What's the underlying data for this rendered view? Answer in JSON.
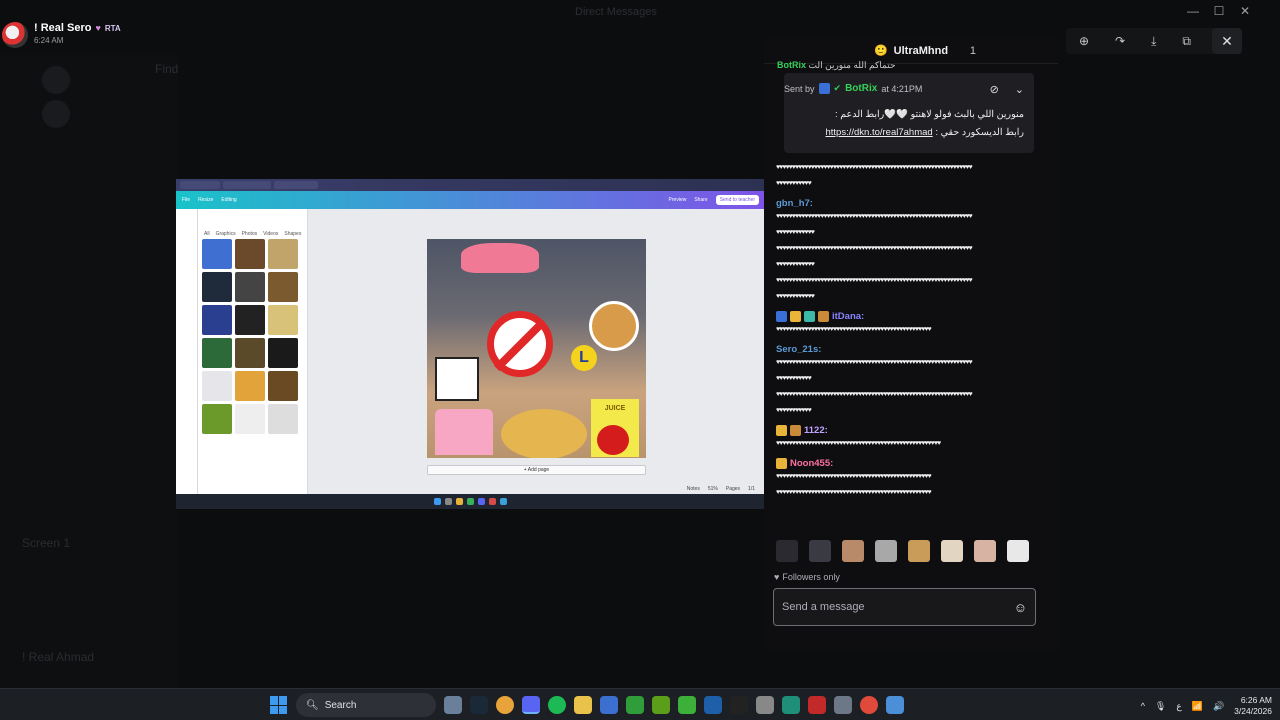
{
  "window": {
    "title": "Direct Messages",
    "controls": [
      "—",
      "☐",
      "✕"
    ]
  },
  "header": {
    "username": "! Real Sero",
    "heart": "♥",
    "badge": "RTA",
    "time": "6:24 AM"
  },
  "background_text": [
    "Find",
    "Screen 1",
    "! Real Ahmad"
  ],
  "viewer": {
    "tools": [
      "⊕",
      "↷",
      "⤓",
      "⧉",
      "···"
    ],
    "close": "✕"
  },
  "stream": {
    "canva_tabs": [
      "File",
      "Resize",
      "Editing"
    ],
    "panel_tabs": [
      "All",
      "Graphics",
      "Photos",
      "Videos",
      "Shapes"
    ],
    "add_page": "+ Add page",
    "preview": "Preview",
    "share": "Share",
    "send": "Send to teacher",
    "footer": [
      "Notes",
      "Pages",
      "1/1",
      "51%"
    ],
    "design_letter": "L",
    "juice": "JUICE"
  },
  "chat": {
    "channel": "UltraMhnd",
    "count": "1",
    "top_partial_user": "BotRix",
    "top_partial_text": "حتماكم الله منورين الت",
    "pinned": {
      "sent_by": "Sent by",
      "user": "BotRix",
      "at": "at 4:21PM",
      "line1": "منورين اللي بالبث فولو لاهنتو 🤍🤍رابط الدعم :",
      "link": "https://dkn.to/real7ahmad",
      "line2": "رابط الديسكورد حقي :"
    },
    "messages": [
      {
        "user": "",
        "color": "#efeff1",
        "lines": [
          "♥♥♥♥♥♥♥♥♥♥♥♥♥♥♥♥♥♥♥♥♥♥♥♥♥♥♥♥♥♥♥♥♥♥♥♥♥♥♥♥♥♥♥♥♥♥♥♥♥♥♥♥♥♥♥♥♥♥♥♥♥♥",
          "♥♥♥♥♥♥♥♥♥♥♥"
        ]
      },
      {
        "user": "gbn_h7:",
        "color": "#5c9bd6",
        "lines": [
          "♥♥♥♥♥♥♥♥♥♥♥♥♥♥♥♥♥♥♥♥♥♥♥♥♥♥♥♥♥♥♥♥♥♥♥♥♥♥♥♥♥♥♥♥♥♥♥♥♥♥♥♥♥♥♥♥♥♥♥♥♥♥",
          "♥♥♥♥♥♥♥♥♥♥♥♥",
          "♥♥♥♥♥♥♥♥♥♥♥♥♥♥♥♥♥♥♥♥♥♥♥♥♥♥♥♥♥♥♥♥♥♥♥♥♥♥♥♥♥♥♥♥♥♥♥♥♥♥♥♥♥♥♥♥♥♥♥♥♥♥",
          "♥♥♥♥♥♥♥♥♥♥♥♥",
          "♥♥♥♥♥♥♥♥♥♥♥♥♥♥♥♥♥♥♥♥♥♥♥♥♥♥♥♥♥♥♥♥♥♥♥♥♥♥♥♥♥♥♥♥♥♥♥♥♥♥♥♥♥♥♥♥♥♥♥♥♥♥",
          "♥♥♥♥♥♥♥♥♥♥♥♥"
        ]
      },
      {
        "user": "itDana:",
        "color": "#8a84ff",
        "lines": [
          "♥♥♥♥♥♥♥♥♥♥♥♥♥♥♥♥♥♥♥♥♥♥♥♥♥♥♥♥♥♥♥♥♥♥♥♥♥♥♥♥♥♥♥♥♥♥♥♥♥"
        ]
      },
      {
        "user": "Sero_21s:",
        "color": "#5c9bd6",
        "lines": [
          "♥♥♥♥♥♥♥♥♥♥♥♥♥♥♥♥♥♥♥♥♥♥♥♥♥♥♥♥♥♥♥♥♥♥♥♥♥♥♥♥♥♥♥♥♥♥♥♥♥♥♥♥♥♥♥♥♥♥♥♥♥♥",
          "♥♥♥♥♥♥♥♥♥♥♥",
          "♥♥♥♥♥♥♥♥♥♥♥♥♥♥♥♥♥♥♥♥♥♥♥♥♥♥♥♥♥♥♥♥♥♥♥♥♥♥♥♥♥♥♥♥♥♥♥♥♥♥♥♥♥♥♥♥♥♥♥♥♥♥",
          "♥♥♥♥♥♥♥♥♥♥♥"
        ]
      },
      {
        "user": "1122:",
        "color": "#bfa3ff",
        "lines": [
          "♥♥♥♥♥♥♥♥♥♥♥♥♥♥♥♥♥♥♥♥♥♥♥♥♥♥♥♥♥♥♥♥♥♥♥♥♥♥♥♥♥♥♥♥♥♥♥♥♥♥♥♥"
        ]
      },
      {
        "user": "Noon455:",
        "color": "#ff6fa3",
        "lines": [
          "♥♥♥♥♥♥♥♥♥♥♥♥♥♥♥♥♥♥♥♥♥♥♥♥♥♥♥♥♥♥♥♥♥♥♥♥♥♥♥♥♥♥♥♥♥♥♥♥♥",
          "♥♥♥♥♥♥♥♥♥♥♥♥♥♥♥♥♥♥♥♥♥♥♥♥♥♥♥♥♥♥♥♥♥♥♥♥♥♥♥♥♥♥♥♥♥♥♥♥♥"
        ]
      }
    ],
    "followers_only": "Followers only",
    "send_placeholder": "Send a message"
  },
  "taskbar": {
    "search": "Search",
    "clock_time": "6:26 AM",
    "clock_date": "3/24/2026",
    "tray": [
      "^",
      "🎙",
      "ع",
      "📶",
      "🔊"
    ]
  }
}
